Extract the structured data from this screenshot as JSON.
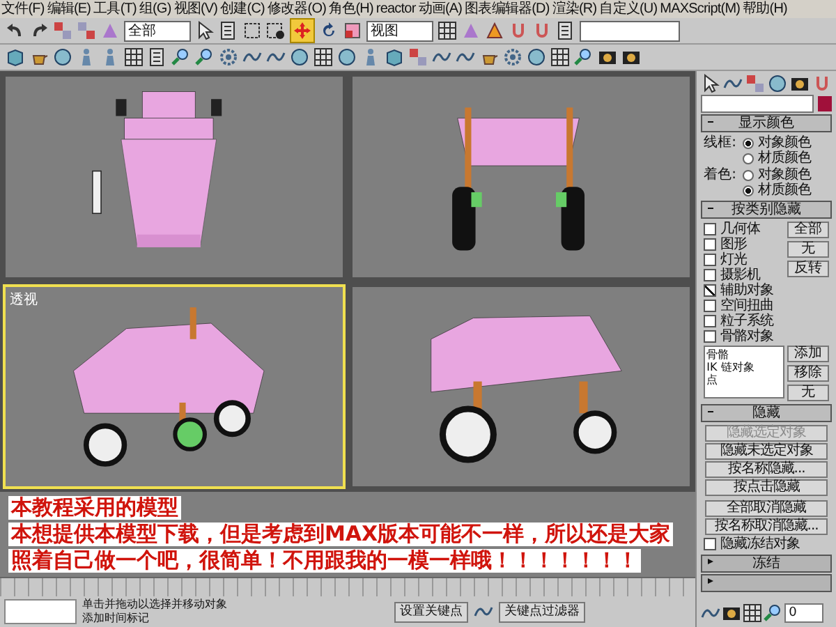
{
  "menu": [
    "文件(F)",
    "编辑(E)",
    "工具(T)",
    "组(G)",
    "视图(V)",
    "创建(C)",
    "修改器(O)",
    "角色(H)",
    "reactor",
    "动画(A)",
    "图表编辑器(D)",
    "渲染(R)",
    "自定义(U)",
    "MAXScript(M)",
    "帮助(H)"
  ],
  "toolbar": {
    "selection_filter": "全部",
    "reference_coord": "视图"
  },
  "viewports": [
    {
      "selected": false
    },
    {
      "selected": false
    },
    {
      "label": "透视",
      "selected": true
    },
    {
      "selected": false
    }
  ],
  "command_panel": {
    "color": "#a0103a",
    "rollouts": [
      {
        "kind": "display_color",
        "title": "显示颜色",
        "expanded": true,
        "groups": [
          {
            "label": "线框:",
            "options": [
              {
                "label": "对象颜色",
                "selected": true
              },
              {
                "label": "材质颜色",
                "selected": false
              }
            ]
          },
          {
            "label": "着色:",
            "options": [
              {
                "label": "对象颜色",
                "selected": false
              },
              {
                "label": "材质颜色",
                "selected": true
              }
            ]
          }
        ]
      },
      {
        "kind": "hide_by_category",
        "title": "按类别隐藏",
        "expanded": true,
        "categories": [
          {
            "label": "几何体",
            "checked": false
          },
          {
            "label": "图形",
            "checked": false
          },
          {
            "label": "灯光",
            "checked": false
          },
          {
            "label": "摄影机",
            "checked": false
          },
          {
            "label": "辅助对象",
            "checked": true
          },
          {
            "label": "空间扭曲",
            "checked": false
          },
          {
            "label": "粒子系统",
            "checked": false
          },
          {
            "label": "骨骼对象",
            "checked": false
          }
        ],
        "buttons": [
          "全部",
          "无",
          "反转"
        ],
        "list": [
          "骨骼",
          "IK 链对象",
          "点"
        ],
        "list_buttons": [
          "添加",
          "移除",
          "无"
        ]
      },
      {
        "kind": "hide",
        "title": "隐藏",
        "expanded": true,
        "buttons": [
          {
            "label": "隐藏选定对象",
            "disabled": true
          },
          {
            "label": "隐藏未选定对象",
            "disabled": false
          },
          {
            "label": "按名称隐藏...",
            "disabled": false
          },
          {
            "label": "按点击隐藏",
            "disabled": false
          },
          {
            "label": "全部取消隐藏",
            "disabled": false
          },
          {
            "label": "按名称取消隐藏...",
            "disabled": false
          }
        ],
        "checkbox": {
          "label": "隐藏冻结对象",
          "checked": false
        }
      },
      {
        "kind": "collapsed",
        "title": "冻结",
        "expanded": false
      },
      {
        "kind": "collapsed",
        "expanded": false
      }
    ]
  },
  "overlay_text": [
    "本教程采用的模型",
    "本想提供本模型下载，但是考虑到MAX版本可能不一样，所以还是大家",
    "照着自己做一个吧，很简单！不用跟我的一模一样哦！！！！！！！"
  ],
  "status": {
    "prompt": "单击并拖动以选择并移动对象",
    "time_tag": "添加时间标记",
    "set_key": "设置关键点",
    "key_filters": "关键点过滤器",
    "frame": "0"
  }
}
